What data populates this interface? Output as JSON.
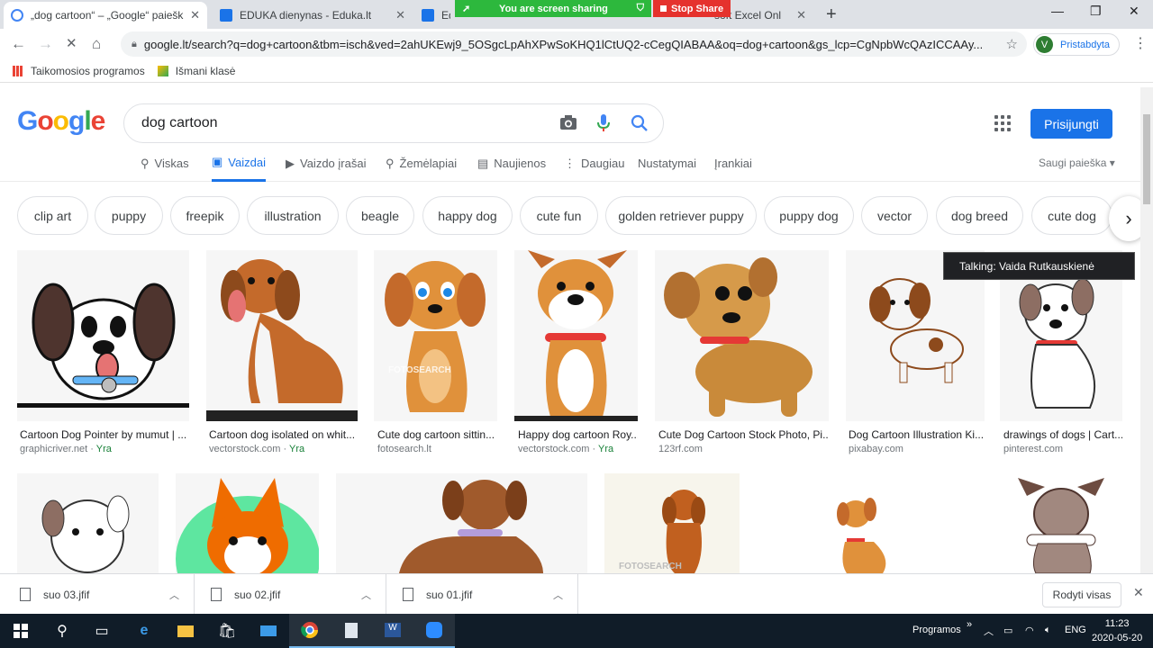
{
  "browser": {
    "tabs": [
      {
        "title": "„dog cartoon“ – „Google“ paiešk",
        "active": true,
        "favicon_color": "#4285f4"
      },
      {
        "title": "EDUKA dienynas - Eduka.lt",
        "active": false,
        "favicon_color": "#1a73e8"
      },
      {
        "title": "Edu",
        "active": false,
        "favicon_color": "#1a73e8"
      },
      {
        "title": "soft Excel Onl",
        "active": false,
        "favicon_color": "#217346"
      }
    ],
    "url": "google.lt/search?q=dog+cartoon&tbm=isch&ved=2ahUKEwj9_5OSgcLpAhXPwSoKHQ1lCtUQ2-cCegQIABAA&oq=dog+cartoon&gs_lcp=CgNpbWcQAzICCAAy...",
    "profile_initial": "V",
    "profile_label": "Pristabdyta",
    "bookmarks": [
      "Taikomosios programos",
      "Išmani klasė"
    ]
  },
  "screen_share": {
    "message": "You are screen sharing",
    "stop_label": "Stop Share"
  },
  "google": {
    "logo": "Google",
    "query": "dog cartoon",
    "signin_label": "Prisijungti",
    "tabs": [
      "Viskas",
      "Vaizdai",
      "Vaizdo įrašai",
      "Žemėlapiai",
      "Naujienos",
      "Daugiau",
      "Nustatymai",
      "Įrankiai"
    ],
    "safe_search": "Saugi paieška ▾",
    "chips": [
      "clip art",
      "puppy",
      "freepik",
      "illustration",
      "beagle",
      "happy dog",
      "cute fun",
      "golden retriever puppy",
      "puppy dog",
      "vector",
      "dog breed",
      "cute dog"
    ]
  },
  "results": [
    {
      "caption": "Cartoon Dog Pointer by mumut | ...",
      "source": "graphicriver.net",
      "tag": "Yra"
    },
    {
      "caption": "Cartoon dog isolated on whit...",
      "source": "vectorstock.com",
      "tag": "Yra"
    },
    {
      "caption": "Cute dog cartoon sittin...",
      "source": "fotosearch.lt",
      "tag": ""
    },
    {
      "caption": "Happy dog cartoon Roy...",
      "source": "vectorstock.com",
      "tag": "Yra"
    },
    {
      "caption": "Cute Dog Cartoon Stock Photo, Pi...",
      "source": "123rf.com",
      "tag": ""
    },
    {
      "caption": "Dog Cartoon Illustration Ki...",
      "source": "pixabay.com",
      "tag": ""
    },
    {
      "caption": "drawings of dogs | Cart...",
      "source": "pinterest.com",
      "tag": ""
    }
  ],
  "watermarks": [
    "FOTOSEARCH",
    "FOTOSEARCH"
  ],
  "tooltip": "Talking: Vaida Rutkauskienė",
  "downloads": {
    "files": [
      "suo 03.jfif",
      "suo 02.jfif",
      "suo 01.jfif"
    ],
    "show_all": "Rodyti visas"
  },
  "taskbar": {
    "programs_label": "Programos",
    "lang": "ENG",
    "time": "11:23",
    "date": "2020-05-20"
  }
}
